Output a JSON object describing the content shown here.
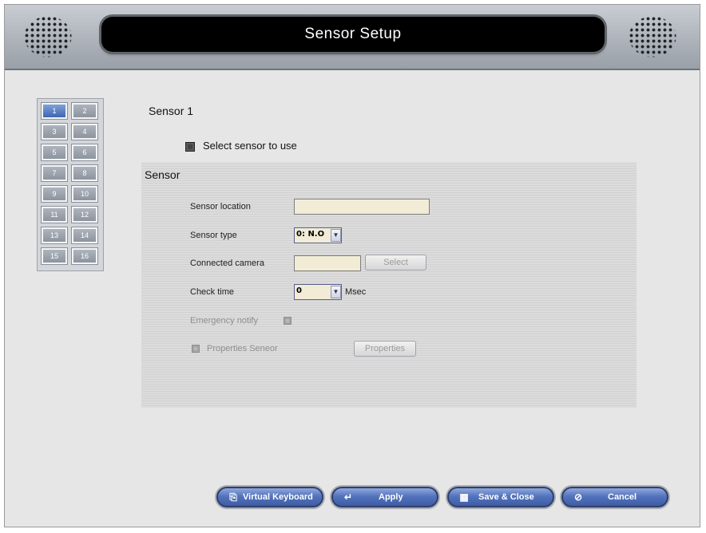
{
  "window": {
    "title": "Sensor Setup"
  },
  "sensor_grid": {
    "cells": [
      "1",
      "2",
      "3",
      "4",
      "5",
      "6",
      "7",
      "8",
      "9",
      "10",
      "11",
      "12",
      "13",
      "14",
      "15",
      "16"
    ],
    "selected": "1"
  },
  "sensor_heading": "Sensor 1",
  "select_sensor": {
    "label": "Select sensor to use",
    "checked": false
  },
  "panel": {
    "title": "Sensor",
    "location": {
      "label": "Sensor location",
      "value": ""
    },
    "type": {
      "label": "Sensor type",
      "value": "0: N.O"
    },
    "camera": {
      "label": "Connected camera",
      "value": "",
      "button": "Select"
    },
    "check_time": {
      "label": "Check time",
      "value": "0",
      "unit": "Msec"
    },
    "emergency": {
      "label": "Emergency notify"
    },
    "properties": {
      "label": "Properties Seneor",
      "button": "Properties"
    }
  },
  "footer": {
    "virtual_keyboard": "Virtual Keyboard",
    "apply": "Apply",
    "save_close": "Save & Close",
    "cancel": "Cancel"
  },
  "icons": {
    "virtual_keyboard": "keyboard-icon",
    "apply": "enter-arrow-icon",
    "save_close": "save-icon",
    "cancel": "cancel-icon"
  },
  "colors": {
    "accent": "#4a6cb4",
    "title_bg": "#000000",
    "input_bg": "#f2ecd7"
  }
}
